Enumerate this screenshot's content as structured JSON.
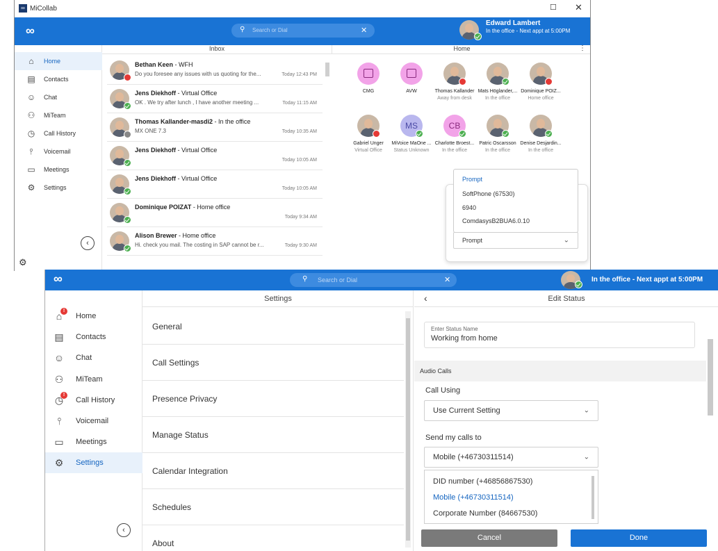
{
  "window": {
    "title": "MiCollab",
    "logo": "∞"
  },
  "header1": {
    "search_placeholder": "Search or Dial",
    "user_name": "Edward Lambert",
    "user_status": "In the office - Next appt at 5:00PM"
  },
  "nav1": [
    {
      "label": "Home",
      "icon": "home-icon"
    },
    {
      "label": "Contacts",
      "icon": "contacts-icon"
    },
    {
      "label": "Chat",
      "icon": "chat-icon"
    },
    {
      "label": "MiTeam",
      "icon": "miteam-icon"
    },
    {
      "label": "Call History",
      "icon": "call-history-icon"
    },
    {
      "label": "Voicemail",
      "icon": "voicemail-icon"
    },
    {
      "label": "Meetings",
      "icon": "meetings-icon"
    },
    {
      "label": "Settings",
      "icon": "settings-icon"
    }
  ],
  "inbox": {
    "title": "Inbox",
    "rows": [
      {
        "name": "Bethan Keen",
        "tag": " - WFH",
        "msg": "Do you foresee any issues with us quoting for the...",
        "time": "Today 12:43 PM",
        "status": "r"
      },
      {
        "name": "Jens Diekhoff",
        "tag": " - Virtual Office",
        "msg": "OK . We try after lunch , I have another meeting ...",
        "time": "Today 11:15 AM",
        "status": "g"
      },
      {
        "name": "Thomas Kallander-masdi2",
        "tag": " - In the office",
        "msg": "MX ONE 7.3",
        "time": "Today 10:35 AM",
        "status": "x"
      },
      {
        "name": "Jens Diekhoff",
        "tag": " - Virtual Office",
        "msg": "",
        "time": "Today 10:05 AM",
        "status": "g"
      },
      {
        "name": "Jens Diekhoff",
        "tag": " - Virtual Office",
        "msg": "",
        "time": "Today 10:05 AM",
        "status": "g"
      },
      {
        "name": "Dominique POIZAT",
        "tag": " - Home office",
        "msg": "",
        "time": "Today 9:34 AM",
        "status": "g"
      },
      {
        "name": "Alison Brewer",
        "tag": " - Home office",
        "msg": "Hi. check you mail. The costing in SAP cannot be r...",
        "time": "Today 9:30 AM",
        "status": "g"
      }
    ]
  },
  "home": {
    "title": "Home",
    "tiles": [
      {
        "name": "CMG",
        "sub": "",
        "kind": "group"
      },
      {
        "name": "AVW",
        "sub": "",
        "kind": "group"
      },
      {
        "name": "Thomas Kallander",
        "sub": "Away from desk",
        "kind": "photo",
        "status": "r"
      },
      {
        "name": "Mats Höglander,...",
        "sub": "In the office",
        "kind": "photo",
        "status": "g"
      },
      {
        "name": "Dominique POIZ...",
        "sub": "Home office",
        "kind": "photo",
        "status": "r"
      },
      {
        "name": "Gabriel Unger",
        "sub": "Virtual Office",
        "kind": "photo",
        "status": "r"
      },
      {
        "name": "MiVoice MaOne ...",
        "sub": "Status Unknown",
        "kind": "MS",
        "status": "g"
      },
      {
        "name": "Charlotte Broest...",
        "sub": "In the office",
        "kind": "CB",
        "status": "g"
      },
      {
        "name": "Patric Oscarsson",
        "sub": "In the office",
        "kind": "photo",
        "status": "g"
      },
      {
        "name": "Denise Desjardin...",
        "sub": "In the office",
        "kind": "photo",
        "status": "g"
      }
    ]
  },
  "popup": {
    "header": "Prompt",
    "options": [
      "SoftPhone (67530)",
      "6940",
      "ComdasysB2BUA6.0.10"
    ],
    "selected": "Prompt"
  },
  "header2": {
    "search_placeholder": "Search or Dial",
    "user_name": "Edward Lambert",
    "user_status": "In the office - Next appt at 5:00PM"
  },
  "nav2": [
    {
      "label": "Home",
      "icon": "home-icon",
      "badge": "!"
    },
    {
      "label": "Contacts",
      "icon": "contacts-icon"
    },
    {
      "label": "Chat",
      "icon": "chat-icon"
    },
    {
      "label": "MiTeam",
      "icon": "miteam-icon"
    },
    {
      "label": "Call History",
      "icon": "call-history-icon",
      "badge": "!"
    },
    {
      "label": "Voicemail",
      "icon": "voicemail-icon"
    },
    {
      "label": "Meetings",
      "icon": "meetings-icon"
    },
    {
      "label": "Settings",
      "icon": "settings-icon",
      "active": true
    }
  ],
  "settings": {
    "title": "Settings",
    "items": [
      "General",
      "Call Settings",
      "Presence Privacy",
      "Manage Status",
      "Calendar Integration",
      "Schedules",
      "About"
    ]
  },
  "edit_status": {
    "title": "Edit Status",
    "name_label": "Enter Status Name",
    "name_value": "Working from home",
    "section": "Audio Calls",
    "call_using_label": "Call Using",
    "call_using_value": "Use Current Setting",
    "send_label": "Send my calls to",
    "send_value": "Mobile (+46730311514)",
    "options": [
      "DID number (+46856867530)",
      "Mobile (+46730311514)",
      "Corporate Number (84667530)"
    ],
    "cancel": "Cancel",
    "done": "Done"
  },
  "colors": {
    "brand": "#1973d4",
    "link": "#1565c0",
    "cancel": "#7a7a7a"
  }
}
